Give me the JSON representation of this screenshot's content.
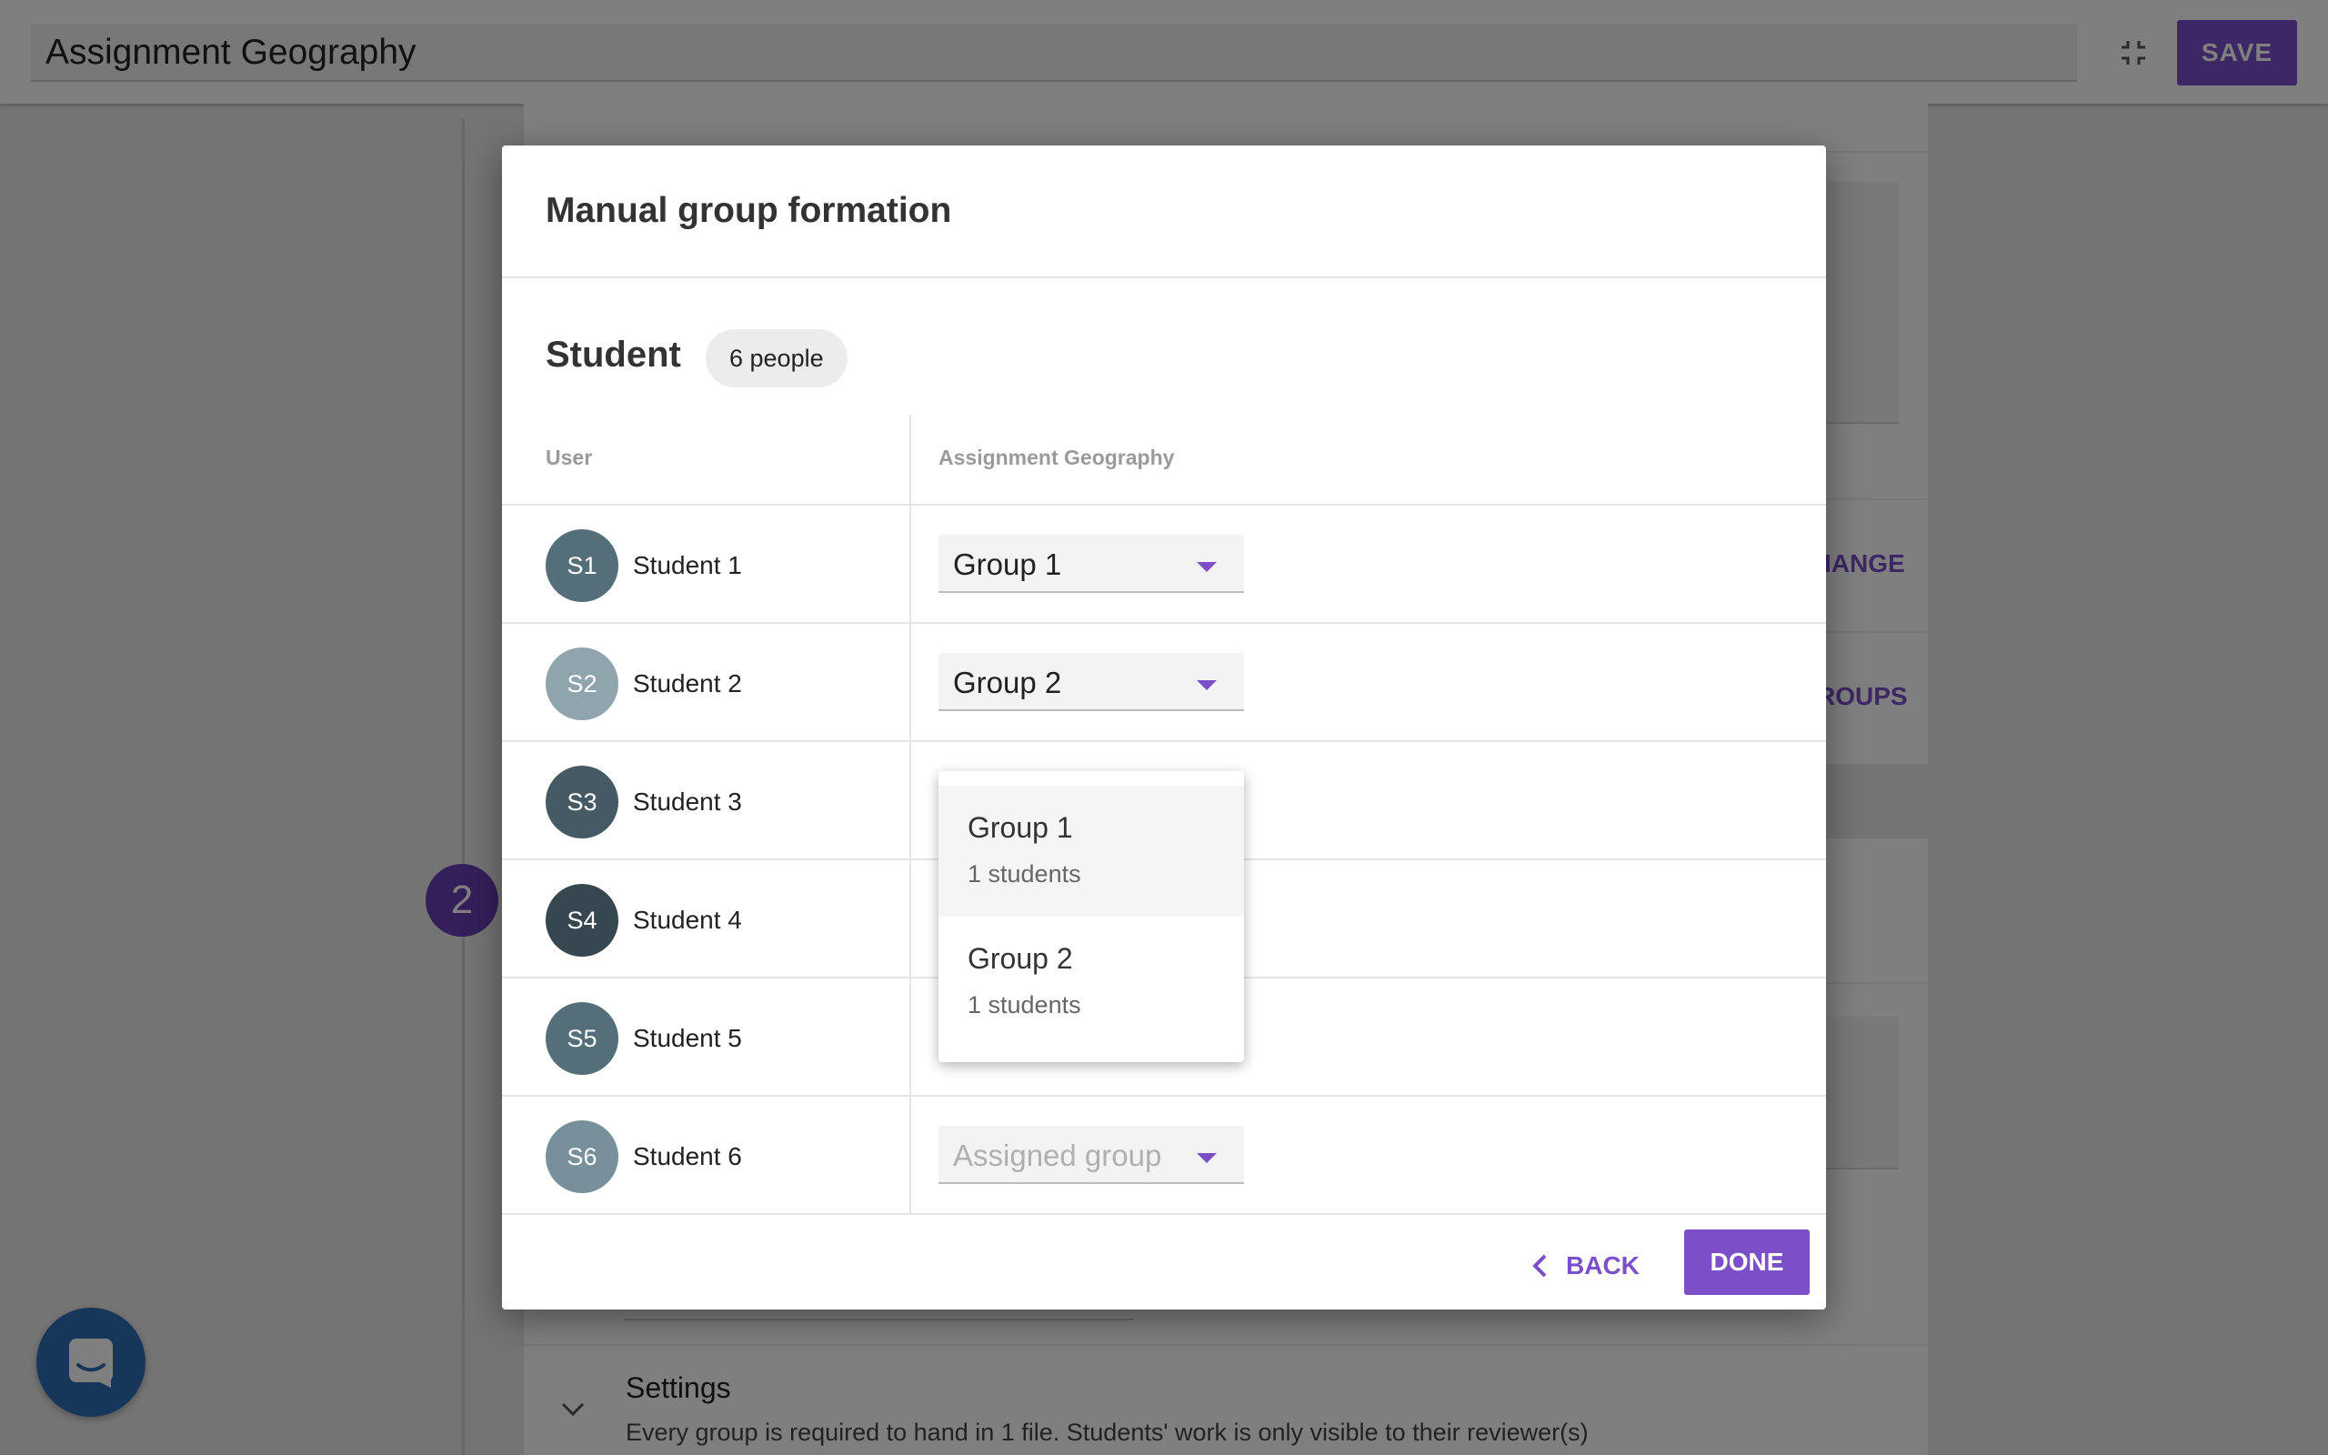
{
  "app": {
    "title": "Assignment Geography",
    "save_label": "SAVE",
    "accent_color": "#7a4fc8",
    "step_number": "2"
  },
  "background": {
    "link_1": "IANGE",
    "link_2": "ROUPS",
    "settings_title": "Settings",
    "settings_desc": "Every group is required to hand in 1 file. Students' work is only visible to their reviewer(s)"
  },
  "dialog": {
    "title": "Manual group formation",
    "section_title": "Student",
    "count_badge": "6 people",
    "columns": {
      "user": "User",
      "assignment": "Assignment Geography"
    },
    "rows": [
      {
        "initials": "S1",
        "name": "Student 1",
        "avatar_color": "#546e7a",
        "group": "Group 1"
      },
      {
        "initials": "S2",
        "name": "Student 2",
        "avatar_color": "#90a4ae",
        "group": "Group 2"
      },
      {
        "initials": "S3",
        "name": "Student 3",
        "avatar_color": "#455a64",
        "group": ""
      },
      {
        "initials": "S4",
        "name": "Student 4",
        "avatar_color": "#37474f",
        "group": ""
      },
      {
        "initials": "S5",
        "name": "Student 5",
        "avatar_color": "#546e7a",
        "group": ""
      },
      {
        "initials": "S6",
        "name": "Student 6",
        "avatar_color": "#78909c",
        "group": ""
      }
    ],
    "placeholder": "Assigned group",
    "back_label": "BACK",
    "done_label": "DONE"
  },
  "dropdown": {
    "options": [
      {
        "title": "Group 1",
        "subtitle": "1 students"
      },
      {
        "title": "Group 2",
        "subtitle": "1 students"
      }
    ]
  }
}
